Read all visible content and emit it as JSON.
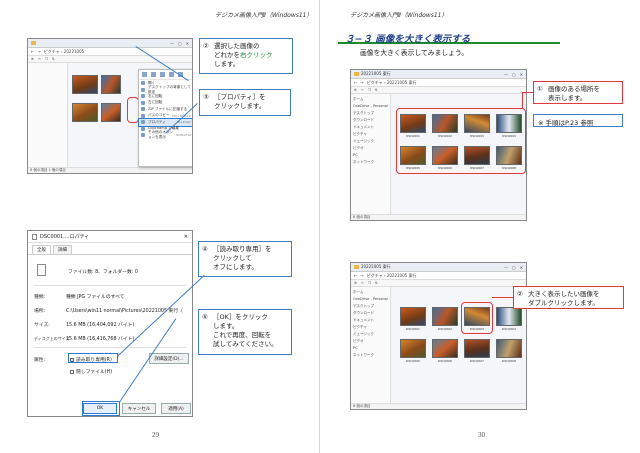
{
  "left_page": {
    "running_head": "デジカメ画像入門Ⅱ（Windows11）",
    "page_number": "29",
    "explorer_shot": {
      "address": "ピクチャ › 20221005",
      "status": "8 個の項目  1 個の項目",
      "context_menu": {
        "items": [
          "開く",
          "デスクトップの背景として設定",
          "右に回転",
          "左に回転",
          "ZIP ファイルに圧縮する",
          "パスのコピー",
          "プロパティ",
          "Clipchamp で編集",
          "その他のオプションを表示"
        ],
        "shortcuts": [
          "",
          "",
          "",
          "",
          "",
          "Ctrl+Shift+C",
          "Alt+Enter",
          "",
          "Shift+F10"
        ],
        "selected_index": 6
      }
    },
    "callout_2": {
      "num": "②",
      "line1": "選択した画像の",
      "line2_pre": "どれかを",
      "line2_hl": "右クリック",
      "line3": "します。"
    },
    "callout_3": {
      "num": "③",
      "line1": "［プロパティ］を",
      "line2": "クリックします。"
    },
    "dialog": {
      "title": "DSC0001....ロパティ",
      "tabs": [
        "全般",
        "詳細"
      ],
      "file_info": "ファイル数: 8、フォルダー数: 0",
      "rows": [
        {
          "k": "種類:",
          "v": "種類 JPG ファイルのすべて"
        },
        {
          "k": "場所:",
          "v": "C:\\Users\\win11 normal\\Pictures\\20221005 東行（"
        },
        {
          "k": "サイズ:",
          "v": "15.6 MB (16,404,092 バイト)"
        },
        {
          "k": "ディスク上のサイズ:",
          "v": "15.6 MB (16,416,768 バイト)"
        }
      ],
      "attr_label": "属性:",
      "readonly_label": "読み取り専用(R)",
      "hidden_label": "隠しファイル(H)",
      "advanced_button": "詳細設定(D)...",
      "ok_button": "OK",
      "cancel_button": "キャンセル",
      "apply_button": "適用(A)"
    },
    "callout_4": {
      "num": "④",
      "line1": "［読み取り専用］を",
      "line2": "クリックして",
      "line3": "オフにします。"
    },
    "callout_5": {
      "num": "⑤",
      "line1": "［OK］をクリック",
      "line2": "します。",
      "line3": "これで再度、回転を",
      "line4": "試してみてください。"
    }
  },
  "right_page": {
    "running_head": "デジカメ画像入門Ⅱ（Windows11）",
    "page_number": "30",
    "section_title": "３−３ 画像を大きく表示する",
    "section_sub": "画像を大きく表示してみましょう。",
    "shot1": {
      "title": "20221005 東行",
      "address": "ピクチャ › 20221005 東行",
      "nav": [
        "ホーム",
        "OneDrive - Personal",
        "デスクトップ",
        "ダウンロード",
        "ドキュメント",
        "ピクチャ",
        "ミュージック",
        "ビデオ",
        "PC",
        "ネットワーク"
      ],
      "status": "8 個の項目",
      "thumbs": [
        "DSC0001",
        "DSC0002",
        "DSC0003",
        "DSC0004",
        "DSC0005",
        "DSC0006",
        "DSC0007",
        "DSC0008"
      ]
    },
    "callout_1": {
      "num": "①",
      "line1": "画像のある場所を",
      "line2": "表示します。"
    },
    "note": "※ 手順はP.23 参照",
    "shot2": {
      "title": "20221005 東行",
      "address": "ピクチャ › 20221005 東行",
      "nav": [
        "ホーム",
        "OneDrive - Personal",
        "デスクトップ",
        "ダウンロード",
        "ドキュメント",
        "ピクチャ",
        "ミュージック",
        "ビデオ",
        "PC",
        "ネットワーク"
      ],
      "status": "8 個の項目",
      "thumbs": [
        "DSC0001",
        "DSC0002",
        "DSC0003",
        "DSC0004",
        "DSC0005",
        "DSC0006",
        "DSC0007",
        "DSC0008"
      ]
    },
    "callout_2": {
      "num": "②",
      "line1": "大きく表示したい画像を",
      "line2": "ダブルクリックします。"
    }
  }
}
